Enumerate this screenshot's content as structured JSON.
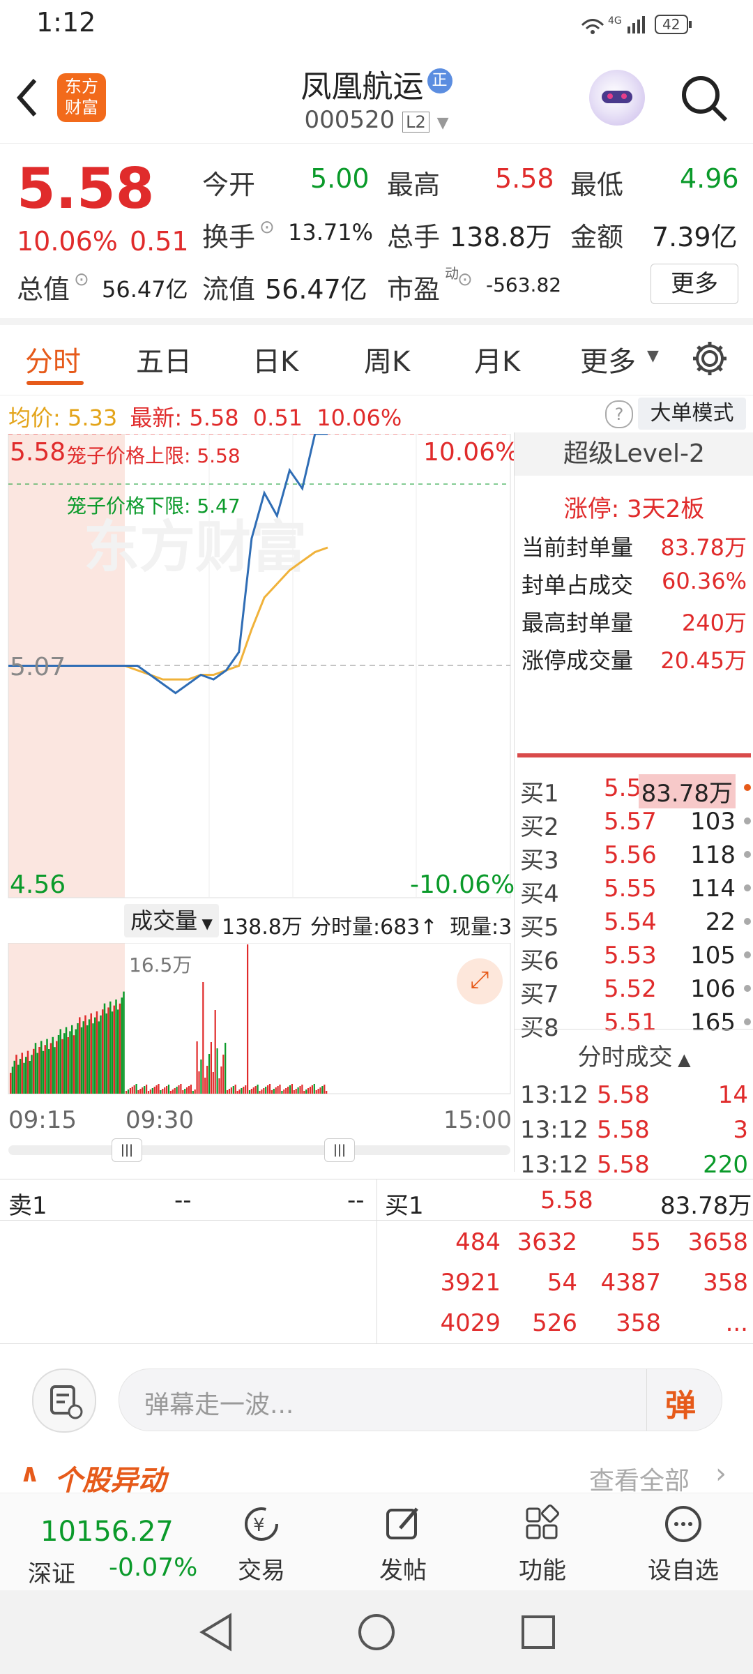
{
  "status_bar": {
    "time": "1:12",
    "network": "4G",
    "battery": "42"
  },
  "header": {
    "logo_line1": "东方",
    "logo_line2": "财富",
    "stock_name": "凤凰航运",
    "badge": "正",
    "stock_code": "000520",
    "level_tag": "L2"
  },
  "quote": {
    "price": "5.58",
    "change_pct": "10.06%",
    "change_amt": "0.51",
    "open_label": "今开",
    "open_value": "5.00",
    "high_label": "最高",
    "high_value": "5.58",
    "low_label": "最低",
    "low_value": "4.96",
    "turnover_label": "换手",
    "turnover_value": "13.71%",
    "volume_label": "总手",
    "volume_value": "138.8万",
    "amount_label": "金额",
    "amount_value": "7.39亿",
    "mktcap_label": "总值",
    "mktcap_value": "56.47亿",
    "float_label": "流值",
    "float_value": "56.47亿",
    "pe_label": "市盈",
    "pe_sup": "动",
    "pe_value": "-563.82",
    "more_button": "更多"
  },
  "tabs": [
    "分时",
    "五日",
    "日K",
    "周K",
    "月K",
    "更多"
  ],
  "chart": {
    "avg_label": "均价:",
    "avg_value": "5.33",
    "last_label": "最新:",
    "last_value": "5.58",
    "last_chg": "0.51",
    "last_pct": "10.06%",
    "big_order_button": "大单模式",
    "top_price": "5.58",
    "top_pct": "10.06%",
    "upper_limit_label": "笼子价格上限: 5.58",
    "lower_limit_label": "笼子价格下限: 5.47",
    "mid_price": "5.07",
    "bottom_price": "4.56",
    "bottom_pct": "-10.06%",
    "volume_label": "成交量",
    "volume_total": "138.8万",
    "tick_vol": "分时量:683↑",
    "cur_vol": "现量:3",
    "vol_max": "16.5万",
    "time_start": "09:15",
    "time_mid": "09:30",
    "time_end": "15:00",
    "watermark": "东方财富"
  },
  "chart_data": {
    "type": "line",
    "prev_close": 5.07,
    "ylim": [
      4.56,
      5.58
    ],
    "series": [
      {
        "name": "",
        "values": [
          5.07,
          5.07,
          5.05,
          5.03,
          5.01,
          5.03,
          5.05,
          5.04,
          5.06,
          5.1,
          5.35,
          5.45,
          5.4,
          5.5,
          5.46,
          5.58,
          5.58
        ]
      },
      {
        "name": "均价",
        "values": [
          5.07,
          5.06,
          5.05,
          5.04,
          5.04,
          5.04,
          5.05,
          5.05,
          5.06,
          5.07,
          5.15,
          5.22,
          5.25,
          5.28,
          5.3,
          5.32,
          5.33
        ]
      }
    ]
  },
  "level2": {
    "title": "超级Level-2",
    "limit_text": "涨停: 3天2板",
    "rows": [
      {
        "label": "当前封单量",
        "value": "83.78万"
      },
      {
        "label": "封单占成交",
        "value": "60.36%"
      },
      {
        "label": "最高封单量",
        "value": "240万"
      },
      {
        "label": "涨停成交量",
        "value": "20.45万"
      }
    ]
  },
  "bids": [
    {
      "label": "买1",
      "price": "5.58",
      "vol": "83.78万"
    },
    {
      "label": "买2",
      "price": "5.57",
      "vol": "103"
    },
    {
      "label": "买3",
      "price": "5.56",
      "vol": "118"
    },
    {
      "label": "买4",
      "price": "5.55",
      "vol": "114"
    },
    {
      "label": "买5",
      "price": "5.54",
      "vol": "22"
    },
    {
      "label": "买6",
      "price": "5.53",
      "vol": "105"
    },
    {
      "label": "买7",
      "price": "5.52",
      "vol": "106"
    },
    {
      "label": "买8",
      "price": "5.51",
      "vol": "165"
    }
  ],
  "ticks": {
    "header": "分时成交",
    "rows": [
      {
        "time": "13:12",
        "price": "5.58",
        "vol": "14"
      },
      {
        "time": "13:12",
        "price": "5.58",
        "vol": "3"
      },
      {
        "time": "13:12",
        "price": "5.58",
        "vol": "220"
      }
    ]
  },
  "queue": {
    "sell_label": "卖1",
    "sell_price": "--",
    "sell_vol": "--",
    "buy_label": "买1",
    "buy_price": "5.58",
    "buy_vol": "83.78万",
    "rows": [
      [
        "484",
        "3632",
        "55",
        "3658"
      ],
      [
        "3921",
        "54",
        "4387",
        "358"
      ],
      [
        "4029",
        "526",
        "358",
        "..."
      ]
    ]
  },
  "danmu": {
    "placeholder": "弹幕走一波...",
    "send": "弹"
  },
  "alert": {
    "title": "个股异动",
    "view_all": "查看全部"
  },
  "bottom_nav": {
    "index_value": "10156.27",
    "index_name": "深证",
    "index_pct": "-0.07%",
    "items": [
      "交易",
      "发帖",
      "功能",
      "设自选"
    ]
  }
}
